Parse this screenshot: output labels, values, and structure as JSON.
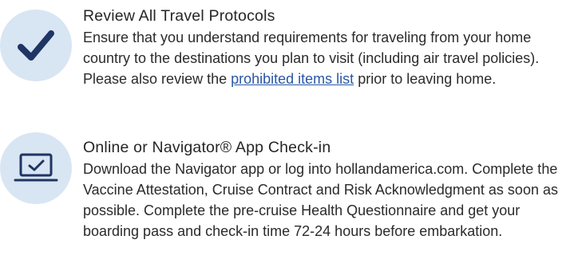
{
  "sections": [
    {
      "icon": "checkmark-icon",
      "title": "Review All Travel Protocols",
      "body_before_link": "Ensure that you understand requirements for traveling from your home country to the destinations you plan to visit (including air travel policies).  Please also review the ",
      "link_text": "prohibited items list",
      "body_after_link": " prior to leaving home."
    },
    {
      "icon": "laptop-check-icon",
      "title": "Online or Navigator® App Check-in",
      "body": "Download the Navigator app or log into hollandamerica.com. Complete the Vaccine Attestation, Cruise Contract and Risk Acknowledgment as soon as possible.  Complete the pre-cruise Health Questionnaire and get your boarding pass and check-in time 72-24 hours before embarkation."
    }
  ],
  "colors": {
    "icon_background": "#d8e5f3",
    "icon_stroke": "#1f3563",
    "link": "#2a57a6",
    "text": "#2b2b2b"
  }
}
